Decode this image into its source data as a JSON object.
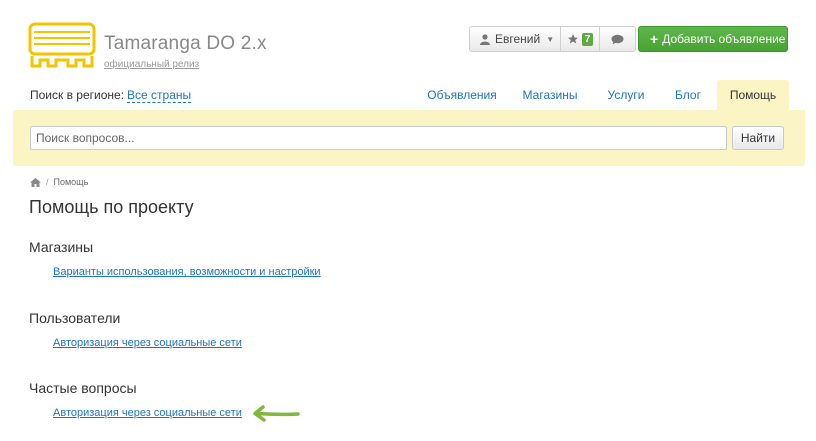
{
  "brand": {
    "title": "Tamaranga DO 2.x",
    "subtitle": "официальный релиз"
  },
  "topbar": {
    "user_name": "Евгений",
    "favorites_count": "7",
    "add_label": "Добавить объявление"
  },
  "region": {
    "label": "Поиск в регионе:",
    "value": "Все страны"
  },
  "nav": [
    "Объявления",
    "Магазины",
    "Услуги",
    "Блог",
    "Помощь"
  ],
  "search": {
    "placeholder": "Поиск вопросов...",
    "button": "Найти"
  },
  "breadcrumb": {
    "current": "Помощь"
  },
  "page": {
    "title": "Помощь по проекту",
    "sections": [
      {
        "title": "Магазины",
        "link": "Варианты использования, возможности и настройки"
      },
      {
        "title": "Пользователи",
        "link": "Авторизация через социальные сети"
      },
      {
        "title": "Частые вопросы",
        "link": "Авторизация через социальные сети"
      }
    ]
  },
  "colors": {
    "accent": "#5fa943",
    "link": "#1e73be",
    "panel": "#fbf4c4",
    "logo": "#f5c400",
    "arrow": "#7fb83a"
  }
}
